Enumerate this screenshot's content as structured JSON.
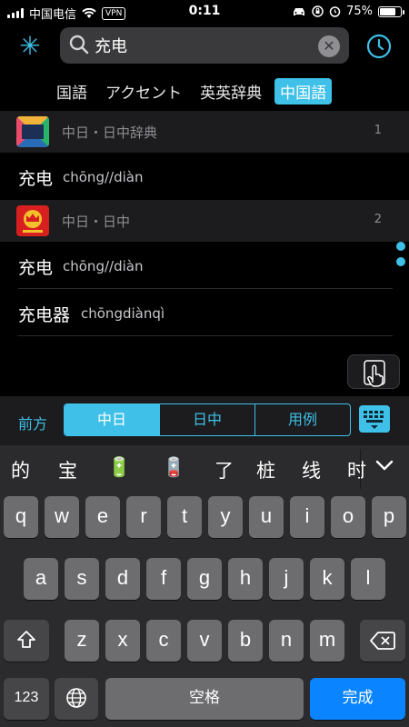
{
  "status": {
    "carrier": "中国电信",
    "vpn": "VPN",
    "time": "0:11",
    "battery": "75%",
    "battery_level": 0.75
  },
  "search": {
    "value": "充电",
    "placeholder": ""
  },
  "dict_tabs": [
    "国語",
    "アクセント",
    "英英辞典",
    "中国語"
  ],
  "active_tab": 3,
  "sections": [
    {
      "title": "中日・日中辞典",
      "count": "1",
      "logo_text": "中日日中辞典",
      "entries": [
        {
          "word": "充电",
          "pinyin": "chōng//diàn"
        }
      ]
    },
    {
      "title": "中日・日中",
      "count": "2",
      "logo_text": "",
      "entries": [
        {
          "word": "充电",
          "pinyin": "chōng//diàn"
        },
        {
          "word": "充电器",
          "pinyin": "chōngdiànqì"
        }
      ]
    }
  ],
  "segment": {
    "label": "前方",
    "options": [
      "中日",
      "日中",
      "用例"
    ],
    "selected": 0
  },
  "keyboard": {
    "candidates": [
      "的",
      "宝",
      "🔋",
      "🪫",
      "了",
      "桩",
      "线",
      "时"
    ],
    "row1": [
      "q",
      "w",
      "e",
      "r",
      "t",
      "y",
      "u",
      "i",
      "o",
      "p"
    ],
    "row2": [
      "a",
      "s",
      "d",
      "f",
      "g",
      "h",
      "j",
      "k",
      "l"
    ],
    "row3": [
      "z",
      "x",
      "c",
      "v",
      "b",
      "n",
      "m"
    ],
    "numbers_key": "123",
    "space_key": "空格",
    "return_key": "完成"
  },
  "colors": {
    "accent": "#3ec0e8",
    "return_key": "#0a84ff"
  }
}
